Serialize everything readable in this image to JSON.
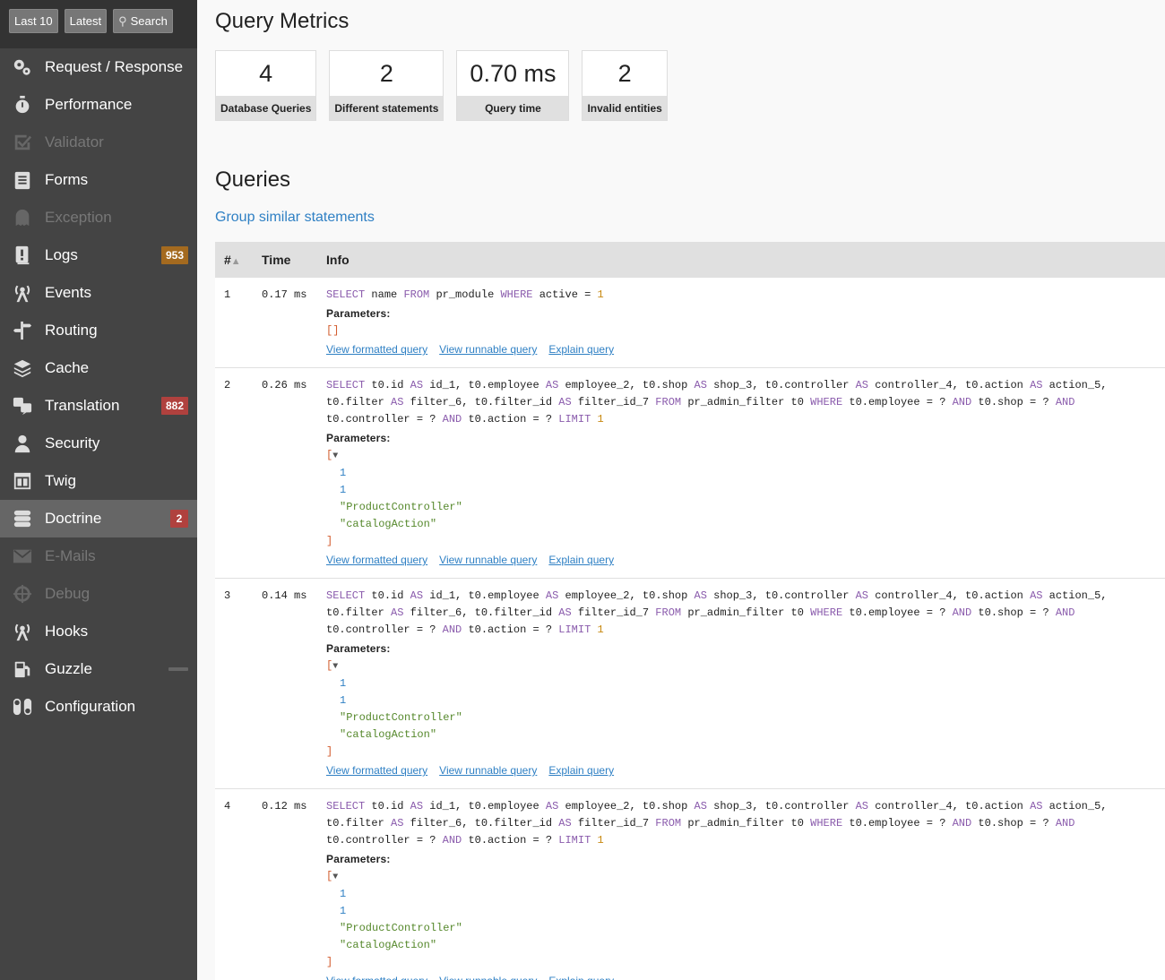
{
  "toolbar": {
    "last10": "Last 10",
    "latest": "Latest",
    "search": "Search"
  },
  "menu": [
    {
      "label": "Request / Response",
      "icon": "gears-icon",
      "state": "normal"
    },
    {
      "label": "Performance",
      "icon": "stopwatch-icon",
      "state": "normal"
    },
    {
      "label": "Validator",
      "icon": "checkbox-icon",
      "state": "disabled"
    },
    {
      "label": "Forms",
      "icon": "form-icon",
      "state": "normal"
    },
    {
      "label": "Exception",
      "icon": "ghost-icon",
      "state": "disabled"
    },
    {
      "label": "Logs",
      "icon": "log-icon",
      "state": "normal",
      "badge": "953",
      "badge_type": "warn"
    },
    {
      "label": "Events",
      "icon": "antenna-icon",
      "state": "normal"
    },
    {
      "label": "Routing",
      "icon": "signpost-icon",
      "state": "normal"
    },
    {
      "label": "Cache",
      "icon": "layers-icon",
      "state": "normal"
    },
    {
      "label": "Translation",
      "icon": "translate-icon",
      "state": "normal",
      "badge": "882",
      "badge_type": "err"
    },
    {
      "label": "Security",
      "icon": "user-icon",
      "state": "normal"
    },
    {
      "label": "Twig",
      "icon": "template-icon",
      "state": "normal"
    },
    {
      "label": "Doctrine",
      "icon": "database-icon",
      "state": "active",
      "badge": "2",
      "badge_type": "err"
    },
    {
      "label": "E-Mails",
      "icon": "envelope-icon",
      "state": "disabled"
    },
    {
      "label": "Debug",
      "icon": "crosshair-icon",
      "state": "disabled"
    },
    {
      "label": "Hooks",
      "icon": "antenna-icon",
      "state": "normal"
    },
    {
      "label": "Guzzle",
      "icon": "fuel-icon",
      "state": "normal",
      "dash": true
    },
    {
      "label": "Configuration",
      "icon": "toggles-icon",
      "state": "normal"
    }
  ],
  "main": {
    "metrics_title": "Query Metrics",
    "metrics": [
      {
        "value": "4",
        "label": "Database Queries"
      },
      {
        "value": "2",
        "label": "Different statements"
      },
      {
        "value": "0.70 ms",
        "label": "Query time"
      },
      {
        "value": "2",
        "label": "Invalid entities"
      }
    ],
    "queries_title": "Queries",
    "group_link": "Group similar statements",
    "table": {
      "headers": {
        "num": "#",
        "time": "Time",
        "info": "Info"
      },
      "param_label": "Parameters:",
      "link_labels": [
        "View formatted query",
        "View runnable query",
        "Explain query"
      ],
      "rows": [
        {
          "num": "1",
          "time": "0.17 ms",
          "sql": [
            "SELECT name FROM pr_module WHERE active = 1"
          ],
          "params": [],
          "params_empty": "[]"
        },
        {
          "num": "2",
          "time": "0.26 ms",
          "sql": [
            "SELECT t0.id AS id_1, t0.employee AS employee_2, t0.shop AS shop_3, t0.controller AS controller_4, t0.action AS action_5,",
            "t0.filter AS filter_6, t0.filter_id AS filter_id_7 FROM pr_admin_filter t0 WHERE t0.employee = ? AND t0.shop = ? AND",
            "t0.controller = ? AND t0.action = ? LIMIT 1"
          ],
          "params": [
            "1",
            "1",
            "\"ProductController\"",
            "\"catalogAction\""
          ]
        },
        {
          "num": "3",
          "time": "0.14 ms",
          "sql": [
            "SELECT t0.id AS id_1, t0.employee AS employee_2, t0.shop AS shop_3, t0.controller AS controller_4, t0.action AS action_5,",
            "t0.filter AS filter_6, t0.filter_id AS filter_id_7 FROM pr_admin_filter t0 WHERE t0.employee = ? AND t0.shop = ? AND",
            "t0.controller = ? AND t0.action = ? LIMIT 1"
          ],
          "params": [
            "1",
            "1",
            "\"ProductController\"",
            "\"catalogAction\""
          ]
        },
        {
          "num": "4",
          "time": "0.12 ms",
          "sql": [
            "SELECT t0.id AS id_1, t0.employee AS employee_2, t0.shop AS shop_3, t0.controller AS controller_4, t0.action AS action_5,",
            "t0.filter AS filter_6, t0.filter_id AS filter_id_7 FROM pr_admin_filter t0 WHERE t0.employee = ? AND t0.shop = ? AND",
            "t0.controller = ? AND t0.action = ? LIMIT 1"
          ],
          "params": [
            "1",
            "1",
            "\"ProductController\"",
            "\"catalogAction\""
          ]
        }
      ]
    }
  }
}
